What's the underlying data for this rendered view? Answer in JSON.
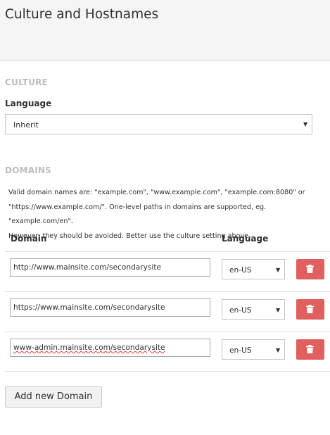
{
  "header": {
    "title": "Culture and Hostnames"
  },
  "culture": {
    "section_label": "CULTURE",
    "language_label": "Language",
    "language_value": "Inherit"
  },
  "domains": {
    "section_label": "DOMAINS",
    "help_lines": [
      "Valid domain names are: \"example.com\", \"www.example.com\", \"example.com:8080\" or",
      "\"https://www.example.com/\". One-level paths in domains are supported, eg. \"example.com/en\".",
      "However, they should be avoided. Better use the culture setting above."
    ],
    "col_domain": "Domain",
    "col_language": "Language",
    "rows": [
      {
        "domain": "http://www.mainsite.com/secondarysite",
        "language": "en-US"
      },
      {
        "domain": "https://www.mainsite.com/secondarysite",
        "language": "en-US"
      },
      {
        "domain": "www-admin.mainsite.com/secondarysite",
        "language": "en-US"
      }
    ],
    "add_button_label": "Add new Domain"
  },
  "icons": {
    "delete": "trash-icon",
    "dropdown": "caret-down-icon"
  },
  "colors": {
    "delete_button": "#e06060",
    "section_label": "#b9bdc5"
  }
}
